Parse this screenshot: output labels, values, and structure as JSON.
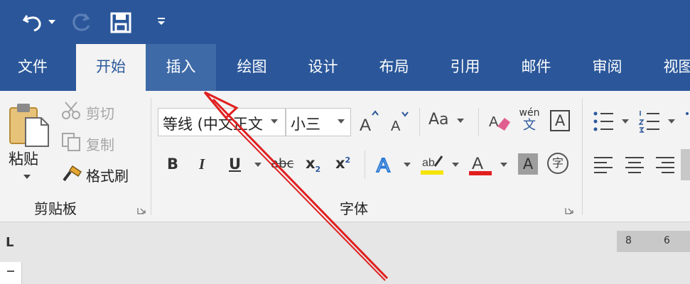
{
  "colors": {
    "title_bar": "#2b579a",
    "ribbon": "#f3f3f3",
    "arrow": "#e01f1f"
  },
  "tabs": [
    "文件",
    "开始",
    "插入",
    "绘图",
    "设计",
    "布局",
    "引用",
    "邮件",
    "审阅",
    "视图"
  ],
  "clipboard": {
    "paste": "粘贴",
    "cut": "剪切",
    "copy": "复制",
    "format_painter": "格式刷",
    "group_label": "剪贴板"
  },
  "font": {
    "font_name": "等线 (中文正文",
    "font_size": "小三",
    "change_case": "Aa",
    "phonetic_top": "wén",
    "phonetic_bottom": "文",
    "border_char": "A",
    "bold": "B",
    "italic": "I",
    "underline": "U",
    "strike": "abc",
    "subscript": "x",
    "subscript_mark": "2",
    "superscript": "x",
    "superscript_mark": "2",
    "char_shading": "A",
    "enclose_char": "字",
    "group_label": "字体"
  },
  "ruler": {
    "corner": "L",
    "numbers": [
      "8",
      "6"
    ]
  }
}
